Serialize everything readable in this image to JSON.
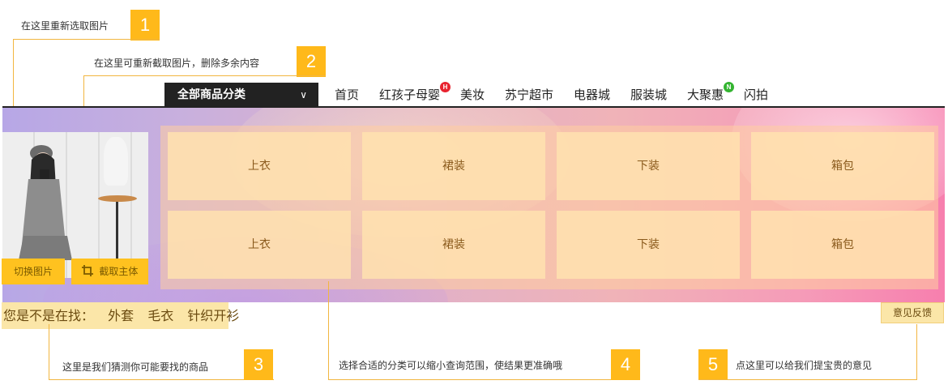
{
  "callouts": [
    {
      "number": "1",
      "text": "在这里重新选取图片"
    },
    {
      "number": "2",
      "text": "在这里可重新截取图片，删除多余内容"
    },
    {
      "number": "3",
      "text": "这里是我们猜测你可能要找的商品"
    },
    {
      "number": "4",
      "text": "选择合适的分类可以缩小查询范围，使结果更准确哦"
    },
    {
      "number": "5",
      "text": "点这里可以给我们提宝贵的意见"
    }
  ],
  "nav": {
    "all_categories": "全部商品分类",
    "items": [
      {
        "label": "首页"
      },
      {
        "label": "红孩子母婴",
        "badge": "H",
        "badge_color": "#e8232f"
      },
      {
        "label": "美妆"
      },
      {
        "label": "苏宁超市"
      },
      {
        "label": "电器城"
      },
      {
        "label": "服装城"
      },
      {
        "label": "大聚惠",
        "badge": "N",
        "badge_color": "#34b431"
      },
      {
        "label": "闪拍"
      }
    ]
  },
  "photo_buttons": {
    "switch": "切换图片",
    "crop": "截取主体",
    "crop_icon": "crop-icon"
  },
  "categories": [
    [
      "上衣",
      "裙装",
      "下装",
      "箱包"
    ],
    [
      "上衣",
      "裙装",
      "下装",
      "箱包"
    ]
  ],
  "suggestion": {
    "prompt": "您是不是在找：",
    "keywords": [
      "外套",
      "毛衣",
      "针织开衫"
    ]
  },
  "feedback": "意见反馈",
  "colors": {
    "accent": "#ffb91a",
    "nav_dark": "#222222",
    "tile": "#ffe2af"
  }
}
